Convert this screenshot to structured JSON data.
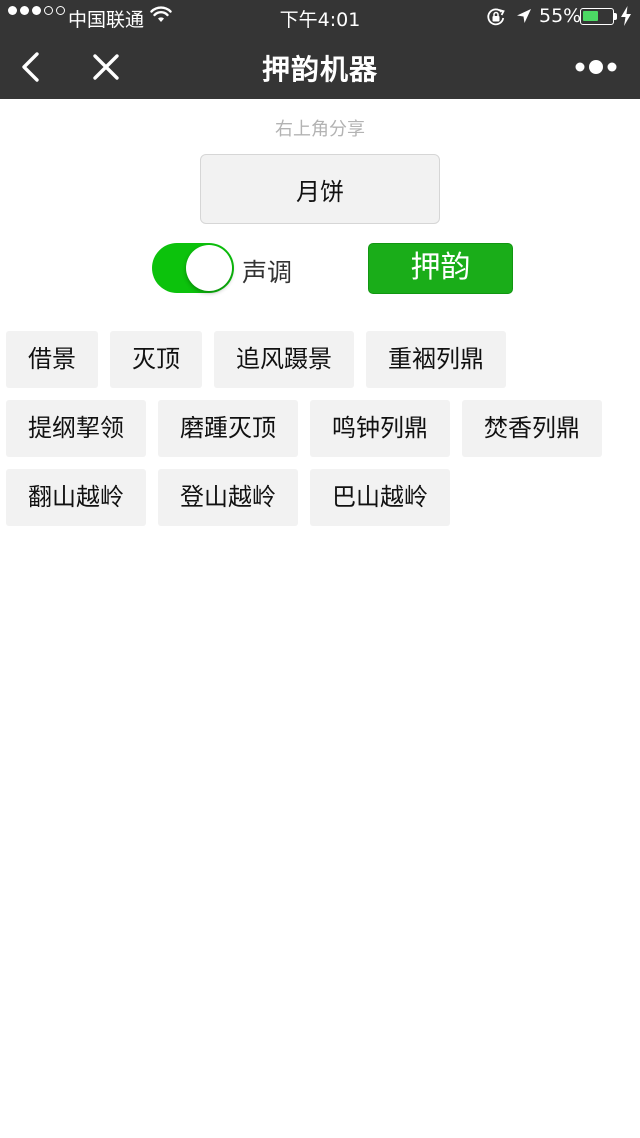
{
  "status_bar": {
    "signal_dots": [
      "on",
      "on",
      "on",
      "off",
      "off"
    ],
    "carrier": "中国联通",
    "time": "下午4:01",
    "battery_percent": "55%",
    "battery_level": 0.55,
    "icons": [
      "wifi-icon",
      "orientation-lock-icon",
      "location-arrow-icon",
      "battery-icon",
      "charging-bolt-icon"
    ]
  },
  "nav": {
    "title": "押韵机器",
    "icons": [
      "back-chevron-icon",
      "close-icon",
      "more-dots-icon"
    ]
  },
  "share_hint": "右上角分享",
  "input": {
    "value": "月饼"
  },
  "tone_toggle": {
    "label": "声调",
    "on": true,
    "color": "#0cc20c"
  },
  "rhyme_button": {
    "label": "押韵",
    "color": "#1aad19"
  },
  "results": [
    "借景",
    "灭顶",
    "追风蹑景",
    "重裀列鼎",
    "提纲挈领",
    "磨踵灭顶",
    "鸣钟列鼎",
    "焚香列鼎",
    "翻山越岭",
    "登山越岭",
    "巴山越岭"
  ]
}
